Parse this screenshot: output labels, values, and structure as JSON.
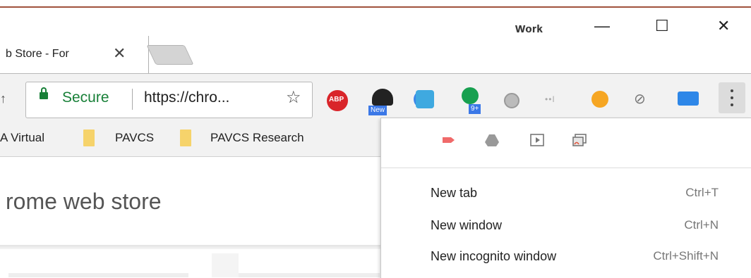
{
  "window": {
    "profile_label": "Work",
    "minimize_glyph": "—",
    "maximize_glyph": "☐",
    "close_glyph": "✕"
  },
  "tab": {
    "title": "b Store - For",
    "close_glyph": "✕"
  },
  "omnibox": {
    "secure_label": "Secure",
    "url": "https://chro...",
    "bookmark_glyph": "☆"
  },
  "extensions": [
    {
      "icon": "adblock-plus-icon",
      "label": "ABP"
    },
    {
      "icon": "speedometer-icon",
      "badge": "New"
    },
    {
      "icon": "person-extension-icon"
    },
    {
      "icon": "cloud-icon"
    },
    {
      "icon": "green-circle-icon",
      "badge": "9+"
    },
    {
      "icon": "gray-circle-icon"
    },
    {
      "icon": "dots-icon",
      "label": "••I"
    },
    {
      "icon": "radiation-icon"
    },
    {
      "icon": "eye-slash-icon"
    },
    {
      "icon": "chat-bubble-icon"
    }
  ],
  "bookmarks": [
    {
      "label": "A Virtual"
    },
    {
      "label": "PAVCS"
    },
    {
      "label": "PAVCS Research"
    }
  ],
  "page": {
    "title": "rome web store"
  },
  "menu": {
    "icons": [
      "cast-icon",
      "drive-icon",
      "play-icon",
      "cast-screen-icon"
    ],
    "items": [
      {
        "label": "New tab",
        "shortcut": "Ctrl+T"
      },
      {
        "label": "New window",
        "shortcut": "Ctrl+N"
      },
      {
        "label": "New incognito window",
        "shortcut": "Ctrl+Shift+N"
      }
    ]
  },
  "colors": {
    "secure_green": "#188038",
    "folder_yellow": "#f6d36b",
    "frame_accent": "#a0523c"
  }
}
